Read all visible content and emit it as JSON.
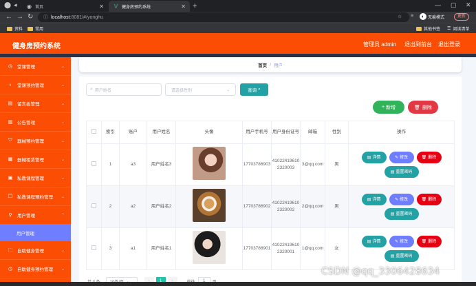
{
  "browser": {
    "tabs": [
      {
        "label": "首页"
      },
      {
        "label": "健身房预约系统"
      }
    ],
    "url_host": "localhost",
    "url_path": ":8081/#/yonghu",
    "profile_label": "无痕模式",
    "update_label": "更新",
    "bookmarks": [
      "资料",
      "常用"
    ],
    "bookmarks_right": [
      "其他书签",
      "阅读清单"
    ]
  },
  "header": {
    "title": "健身房预约系统",
    "admin_label": "管理员 admin",
    "to_front_label": "退出到前台",
    "logout_label": "退出登录"
  },
  "sidebar": {
    "items": [
      {
        "label": "堂课管理"
      },
      {
        "label": "堂课预约管理"
      },
      {
        "label": "留言板管理"
      },
      {
        "label": "公告管理"
      },
      {
        "label": "器械预约管理"
      },
      {
        "label": "器械租赁管理"
      },
      {
        "label": "私教课程管理"
      },
      {
        "label": "私教课程预约管理"
      },
      {
        "label": "用户管理"
      },
      {
        "label": "自助健身管理"
      },
      {
        "label": "自助健身预约管理"
      }
    ],
    "active_sub": "用户管理"
  },
  "breadcrumb": {
    "home": "首页",
    "separator": "/",
    "current": "用户"
  },
  "filters": {
    "name_placeholder": "用户姓名",
    "gender_placeholder": "请选择性别",
    "query_label": "查询"
  },
  "actions": {
    "add_label": "新增",
    "delete_label": "删除"
  },
  "table": {
    "headers": [
      "索引",
      "账户",
      "用户姓名",
      "头像",
      "用户手机号",
      "用户身份证号",
      "邮箱",
      "性别",
      "操作"
    ],
    "rows": [
      {
        "index": "1",
        "account": "a3",
        "name": "用户姓名3",
        "phone": "17703786903",
        "id_card": "410224196102320003",
        "email": "3@qq.com",
        "gender": "男"
      },
      {
        "index": "2",
        "account": "a2",
        "name": "用户姓名2",
        "phone": "17703786902",
        "id_card": "410224196102320002",
        "email": "2@qq.com",
        "gender": "男"
      },
      {
        "index": "3",
        "account": "a1",
        "name": "用户姓名1",
        "phone": "17703786901",
        "id_card": "410224196102320001",
        "email": "1@qq.com",
        "gender": "女"
      }
    ],
    "op_labels": {
      "detail": "详情",
      "edit": "修改",
      "delete": "删除",
      "reset": "重置密码"
    }
  },
  "pagination": {
    "total_label": "共 3 条",
    "page_size_label": "10条/页",
    "current_page": "1",
    "goto_label": "前往",
    "goto_value": "1",
    "page_suffix": "页"
  },
  "watermark": "CSDN @qq_3306428634"
}
